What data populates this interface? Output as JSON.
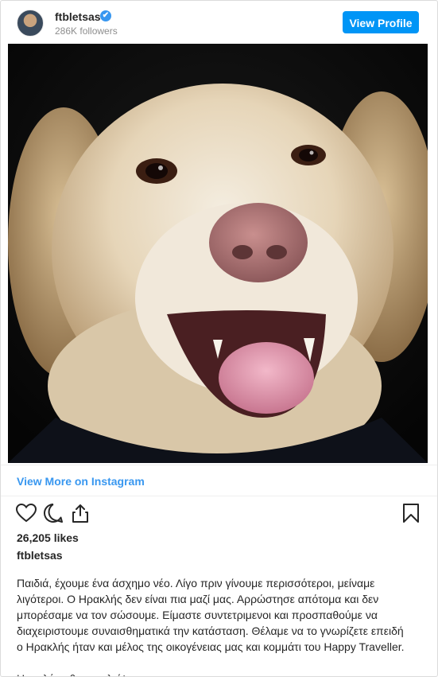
{
  "header": {
    "username": "ftbletsas",
    "verified_mark": "✔",
    "followers": "286K followers",
    "view_profile_label": "View Profile"
  },
  "colors": {
    "accent": "#0095f6",
    "link": "#3897f0",
    "muted": "#8e8e8e",
    "text": "#262626"
  },
  "media": {
    "description_icon": "dog-photo"
  },
  "view_more_label": "View More on Instagram",
  "actions": {
    "icons": [
      "heart-icon",
      "comment-icon",
      "share-icon",
      "bookmark-icon"
    ]
  },
  "likes": "26,205 likes",
  "caption": {
    "username": "ftbletsas",
    "lines": [
      "Παιδιά, έχουμε ένα άσχημο νέο. Λίγο πριν γίνουμε περισσότεροι, μείναμε",
      "λιγότεροι. Ο Ηρακλής δεν είναι πια μαζί μας. Αρρώστησε απότομα και δεν",
      "μπορέσαμε να τον σώσουμε. Είμαστε συντετριμενοι και προσπαθούμε να",
      "διαχειριστουμε συναισθηματικά την κατάσταση. Θέλαμε να το γνωρίζετε επειδή",
      "ο Ηρακλής ήταν και μέλος της οικογένειας μας και κομμάτι του Happy Traveller."
    ],
    "closing": "Ηρακλάκο θα μου λείψεις."
  }
}
